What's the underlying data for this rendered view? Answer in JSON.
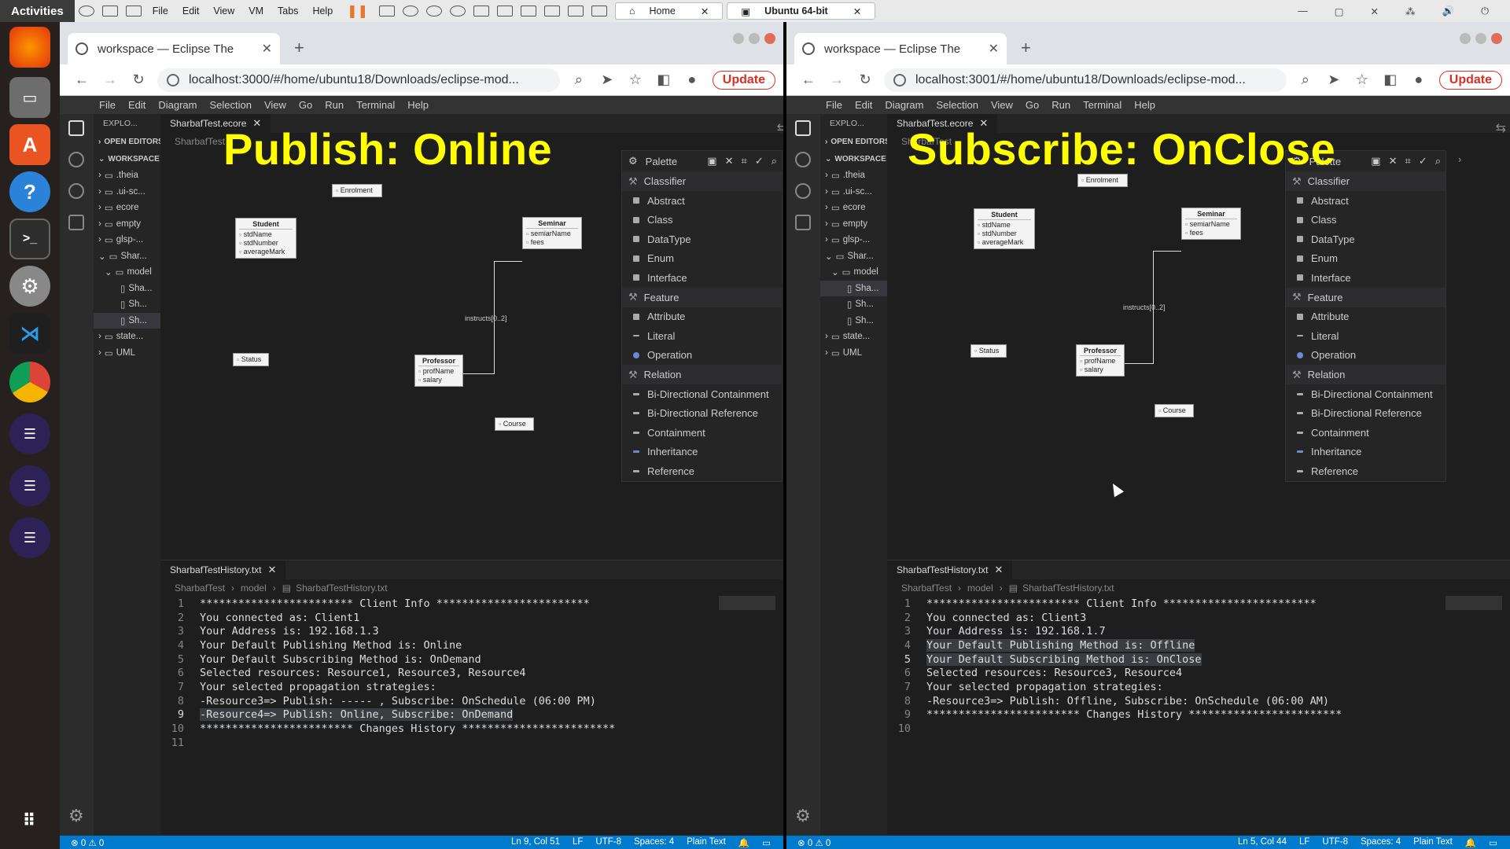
{
  "system": {
    "activities": "Activities",
    "vm_menu": [
      "File",
      "Edit",
      "View",
      "VM",
      "Tabs",
      "Help"
    ],
    "vm_tabs": [
      {
        "label": "Home"
      },
      {
        "label": "Ubuntu 64-bit"
      }
    ]
  },
  "left": {
    "tab_title": "workspace — Eclipse The",
    "url": "localhost:3000/#/home/ubuntu18/Downloads/eclipse-mod...",
    "update": "Update",
    "overlay": "Publish: Online",
    "explorer_title": "EXPLO...",
    "explorer_items": [
      ".theia",
      ".ui-sc...",
      "ecore",
      "empty",
      "glsp-...",
      "Shar...",
      "model",
      "Sha...",
      "Sh...",
      "Sh...",
      "state...",
      "UML"
    ],
    "editor_tab": "SharbafTest.ecore",
    "breadcrumb": "SharbafTest",
    "bottom_tab": "SharbafTestHistory.txt",
    "bottom_breadcrumb": [
      "SharbafTest",
      "model",
      "SharbafTestHistory.txt"
    ],
    "code": [
      "************************ Client Info ************************",
      "You connected as: Client1",
      "Your Address is: 192.168.1.3",
      "Your Default Publishing Method is: Online",
      "Your Default Subscribing Method is: OnDemand",
      "Selected resources: Resource1, Resource3, Resource4",
      "Your selected propagation strategies:",
      "-Resource3=> Publish: ----- , Subscribe: OnSchedule (06:00 PM)",
      "-Resource4=> Publish: Online, Subscribe: OnDemand",
      "************************ Changes History ************************",
      ""
    ],
    "status": {
      "problems": "⊗ 0 ⚠ 0",
      "pos": "Ln 9, Col 51",
      "eol": "LF",
      "enc": "UTF-8",
      "spaces": "Spaces: 4",
      "lang": "Plain Text"
    }
  },
  "right": {
    "tab_title": "workspace — Eclipse The",
    "url": "localhost:3001/#/home/ubuntu18/Downloads/eclipse-mod...",
    "update": "Update",
    "overlay": "Subscribe: OnClose",
    "explorer_title": "EXPLO...",
    "explorer_items": [
      ".theia",
      ".ui-sc...",
      "ecore",
      "empty",
      "glsp-...",
      "Shar...",
      "model",
      "Sha...",
      "Sh...",
      "Sh...",
      "state...",
      "UML"
    ],
    "editor_tab": "SharbafTest.ecore",
    "breadcrumb": "SharbafTest",
    "bottom_tab": "SharbafTestHistory.txt",
    "bottom_breadcrumb": [
      "SharbafTest",
      "model",
      "SharbafTestHistory.txt"
    ],
    "code": [
      "************************ Client Info ************************",
      "You connected as: Client3",
      "Your Address is: 192.168.1.7",
      "Your Default Publishing Method is: Offline",
      "Your Default Subscribing Method is: OnClose",
      "Selected resources: Resource3, Resource4",
      "Your selected propagation strategies:",
      "-Resource3=> Publish: Offline, Subscribe: OnSchedule (06:00 AM)",
      "************************ Changes History ************************",
      ""
    ],
    "status": {
      "problems": "⊗ 0 ⚠ 0",
      "pos": "Ln 5, Col 44",
      "eol": "LF",
      "enc": "UTF-8",
      "spaces": "Spaces: 4",
      "lang": "Plain Text"
    }
  },
  "ide_menu": [
    "File",
    "Edit",
    "Diagram",
    "Selection",
    "View",
    "Go",
    "Run",
    "Terminal",
    "Help"
  ],
  "explorer_sections": {
    "open": "OPEN EDITORS",
    "workspace": "WORKSPACE"
  },
  "diagram": {
    "enrolment": "Enrolment",
    "student": {
      "name": "Student",
      "props": [
        "stdName",
        "stdNumber",
        "averageMark"
      ]
    },
    "seminar": {
      "name": "Seminar",
      "props": [
        "semiarName",
        "fees"
      ]
    },
    "professor": {
      "name": "Professor",
      "props": [
        "profName",
        "salary"
      ]
    },
    "status": "Status",
    "course": "Course",
    "edge_label": "instructs[0..2]"
  },
  "palette": {
    "title": "Palette",
    "groups": [
      {
        "name": "Classifier",
        "items": [
          "Abstract",
          "Class",
          "DataType",
          "Enum",
          "Interface"
        ]
      },
      {
        "name": "Feature",
        "items": [
          "Attribute",
          "Literal",
          "Operation"
        ]
      },
      {
        "name": "Relation",
        "items": [
          "Bi-Directional Containment",
          "Bi-Directional Reference",
          "Containment",
          "Inheritance",
          "Reference"
        ]
      }
    ]
  }
}
